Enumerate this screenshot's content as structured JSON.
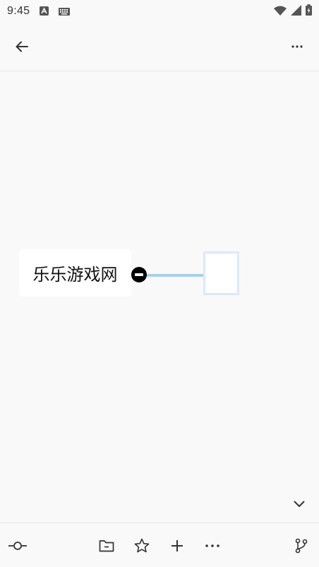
{
  "status_bar": {
    "time": "9:45",
    "left_icons": [
      "a-icon",
      "keyboard-icon"
    ],
    "right_icons": [
      "wifi-icon",
      "signal-icon",
      "battery-icon"
    ]
  },
  "app_bar": {
    "back_icon": "arrow-back-icon",
    "more_icon": "more-horiz-icon"
  },
  "mindmap": {
    "root_label": "乐乐游戏网",
    "child_label": "",
    "connector_color": "#a9cfe6",
    "child_border_color": "#dbe9fb"
  },
  "toolbar": {
    "items": [
      {
        "name": "node-style-icon"
      },
      {
        "name": "folder-icon"
      },
      {
        "name": "star-icon"
      },
      {
        "name": "add-icon"
      },
      {
        "name": "more-horiz-icon"
      },
      {
        "name": "branch-icon"
      }
    ]
  }
}
